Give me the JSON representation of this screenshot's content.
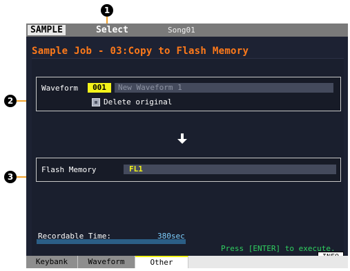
{
  "titlebar": {
    "mode": "SAMPLE",
    "submode": "Select",
    "song": "Song01"
  },
  "job": {
    "title": "Sample Job - 03:Copy to Flash Memory"
  },
  "waveform": {
    "label": "Waveform",
    "number": "001",
    "name": "New Waveform 1"
  },
  "delete_original": {
    "label": "Delete original"
  },
  "flash": {
    "label": "Flash Memory",
    "value": "FL1"
  },
  "recordable": {
    "label": "Recordable Time:",
    "value": "380sec",
    "level": 1.0
  },
  "prompt": {
    "text": "Press [ENTER] to execute."
  },
  "info_button": {
    "label": "INFO"
  },
  "tabs": [
    {
      "label": "Keybank"
    },
    {
      "label": "Waveform"
    },
    {
      "label": "Other",
      "active": true
    }
  ],
  "callouts": [
    "1",
    "2",
    "3"
  ],
  "colors": {
    "title_orange": "#ff7a1a",
    "field_yellow": "#f3f31a",
    "prompt_green": "#30d060",
    "callout_line": "#f2a22b"
  },
  "icons": {
    "arrow": "down-arrow-icon",
    "check": "checkbox-icon"
  }
}
